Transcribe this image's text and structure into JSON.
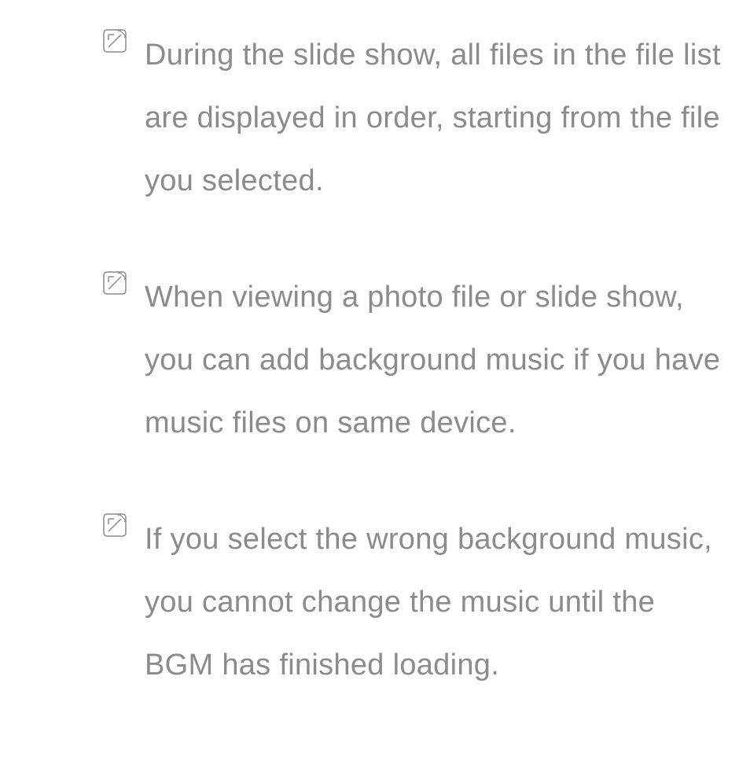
{
  "notes": [
    {
      "text": "During the slide show, all files in the file list are displayed in order, starting from the file you selected."
    },
    {
      "text": "When viewing a photo file or slide show, you can add background music if you have music files on same device."
    },
    {
      "text": "If you select the wrong background music, you cannot change the music until the BGM has finished loading."
    }
  ]
}
